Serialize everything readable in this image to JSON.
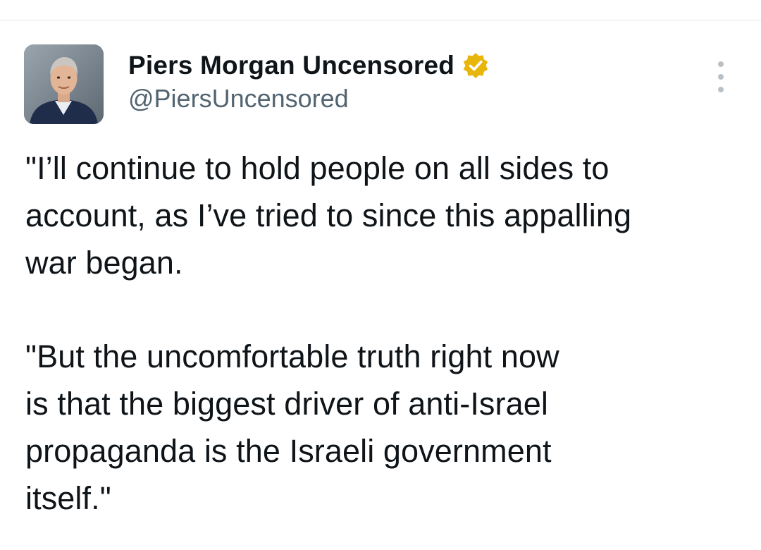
{
  "tweet": {
    "author": {
      "display_name": "Piers Morgan Uncensored",
      "handle": "@PiersUncensored",
      "verified": true,
      "badge_color": "#e8b50b",
      "avatar_icon": "profile-photo"
    },
    "more_icon": "ellipsis-vertical-icon",
    "text_lines": [
      "\"I’ll continue to hold people on all sides to",
      "account, as I’ve tried to since this appalling",
      "war began.",
      "\"But the uncomfortable truth right now",
      "is that the biggest driver of anti-Israel",
      "propaganda is the Israeli government",
      "itself.\""
    ]
  },
  "colors": {
    "text": "#0f1419",
    "secondary_text": "#536471",
    "divider": "#e6e8ea"
  }
}
